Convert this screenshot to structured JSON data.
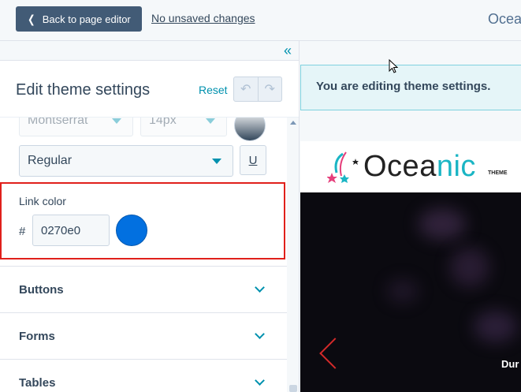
{
  "topbar": {
    "back_label": "Back to page editor",
    "unsaved_label": "No unsaved changes",
    "site_name": "Oceanic"
  },
  "panel": {
    "title": "Edit theme settings",
    "reset_label": "Reset"
  },
  "font": {
    "family": "Montserrat",
    "size": "14px",
    "weight": "Regular",
    "underline_label": "U"
  },
  "link_color": {
    "label": "Link color",
    "hash": "#",
    "hex": "0270e0",
    "swatch": "#0270e0"
  },
  "sections": [
    {
      "label": "Buttons"
    },
    {
      "label": "Forms"
    },
    {
      "label": "Tables"
    }
  ],
  "preview": {
    "banner": "You are editing theme settings.",
    "logo_main": "Ocea",
    "logo_accent": "nic",
    "logo_sub": "THEME",
    "hero_text": "Dur"
  },
  "icons": {
    "collapse": "double-chevron-left-icon",
    "undo": "undo-icon",
    "redo": "redo-icon"
  },
  "colors": {
    "accent": "#0091ae",
    "primary_button": "#425b76",
    "highlight_border": "#e0201b"
  }
}
